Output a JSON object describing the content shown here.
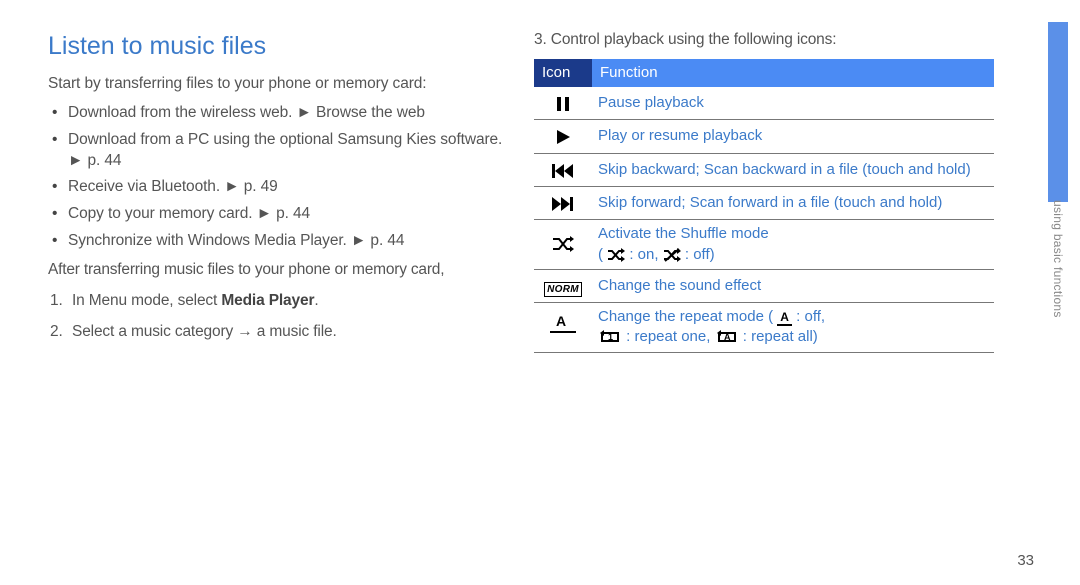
{
  "left": {
    "title": "Listen to music files",
    "intro": "Start by transferring files to your phone or memory card:",
    "bullets": [
      {
        "pre": "Download from the wireless web. ",
        "ref": "► Browse the web"
      },
      {
        "pre": "Download from a PC using the optional Samsung Kies software. ",
        "ref": "► p. 44"
      },
      {
        "pre": "Receive via Bluetooth. ",
        "ref": "► p. 49"
      },
      {
        "pre": "Copy to your memory card. ",
        "ref": "► p. 44"
      },
      {
        "pre": "Synchronize with Windows Media Player. ",
        "ref": "► p. 44"
      }
    ],
    "after": "After transferring music files to your phone or memory card,",
    "step1a": "In Menu mode, select ",
    "step1b": "Media Player",
    "step1c": ".",
    "step2": "Select a music category → a music file."
  },
  "right": {
    "step3": "3.  Control playback using the following icons:",
    "th_icon": "Icon",
    "th_func": "Function",
    "rows": {
      "pause": "Pause playback",
      "play": "Play or resume playback",
      "skipback": "Skip backward; Scan backward in a file (touch and hold)",
      "skipfwd": "Skip forward; Scan forward in a file (touch and hold)",
      "shuffle_a": "Activate the Shuffle mode",
      "shuffle_b1": "( ",
      "shuffle_b2": " : on, ",
      "shuffle_b3": " : off)",
      "soundfx": "Change the sound effect",
      "repeat_a": "Change the repeat mode ( ",
      "repeat_b": " : off,",
      "repeat_c1": ": repeat one, ",
      "repeat_c2": ": repeat all)"
    }
  },
  "sidebar_label": "using basic functions",
  "page_number": "33"
}
